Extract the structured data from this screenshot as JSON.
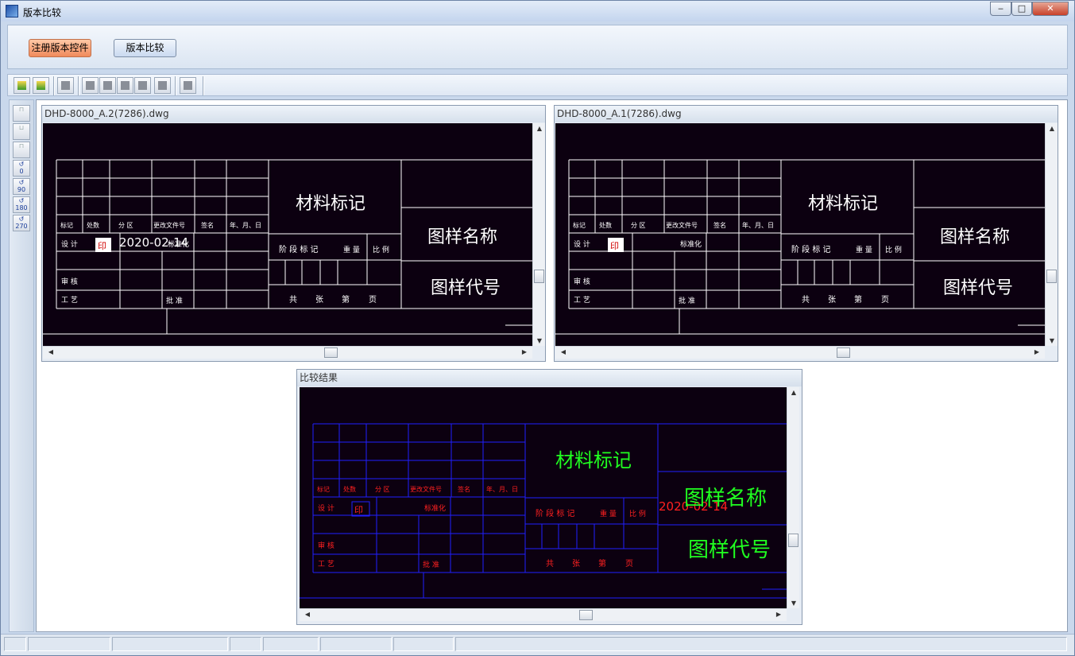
{
  "window": {
    "title": "版本比较",
    "controls": [
      "minimize",
      "maximize",
      "close"
    ]
  },
  "top_buttons": {
    "register": "注册版本控件",
    "compare": "版本比较"
  },
  "toolbar": {
    "icons": [
      "open-icon",
      "open-icon",
      "pointer-icon",
      "layer-icon",
      "lines-icon",
      "arrow-icon",
      "shape-icon",
      "window-icon",
      "settings-icon"
    ]
  },
  "left_tools": {
    "icons": [
      "mirror-icon",
      "mirror-icon",
      "mirror-icon",
      "rotate-icon",
      "rotate-icon",
      "rotate-icon",
      "rotate-icon"
    ],
    "labels": [
      "",
      "",
      "",
      "0",
      "90",
      "180",
      "270"
    ]
  },
  "panel_left": {
    "title": "DHD-8000_A.2(7286).dwg",
    "date": "2020-02-14",
    "name_a": "图样",
    "name_b": "名称",
    "code_a": "图样",
    "code_b": "代号",
    "mat_a": "材料",
    "mat_b": "标记"
  },
  "panel_right": {
    "title": "DHD-8000_A.1(7286).dwg",
    "date": "",
    "name_a": "图样名称",
    "name_b": "",
    "code_a": "图样代号",
    "code_b": "",
    "mat_a": "材料标记",
    "mat_b": ""
  },
  "panel_result": {
    "title": "比较结果",
    "date": "2020-02-14",
    "name": "图样名称",
    "code": "图样代号",
    "mat": "材料标记"
  },
  "drawing": {
    "row_labels": [
      "标记",
      "处数",
      "分 区",
      "更改文件号",
      "签名",
      "年、月、日"
    ],
    "design": "设 计",
    "standard": "标准化",
    "review": "审 核",
    "craft": "工 艺",
    "approve": "批 准",
    "stage": "阶 段 标 记",
    "weight": "重 量",
    "scale": "比 例",
    "total": "共",
    "sheets": "张",
    "page_no": "第",
    "page": "页",
    "stamp": "印"
  },
  "colors": {
    "canvas": "#0c0010",
    "line": "#ffffff",
    "blue": "#2020ff",
    "red": "#ff2020",
    "green": "#20ff20"
  }
}
